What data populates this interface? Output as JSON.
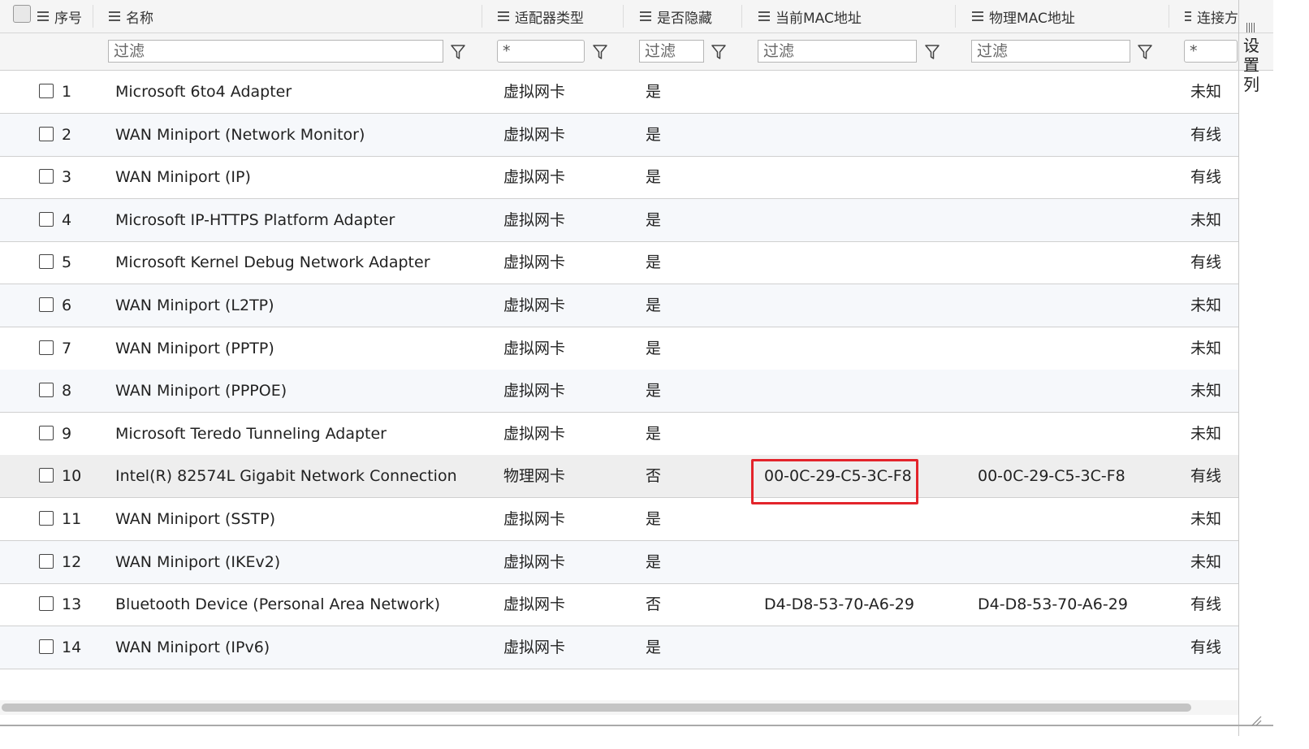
{
  "header": {
    "columns": [
      {
        "label": "序号"
      },
      {
        "label": "名称"
      },
      {
        "label": "适配器类型"
      },
      {
        "label": "是否隐藏"
      },
      {
        "label": "当前MAC地址"
      },
      {
        "label": "物理MAC地址"
      },
      {
        "label": "连接方"
      }
    ]
  },
  "filters": {
    "name": {
      "placeholder": "过滤"
    },
    "adapter_type": {
      "value": "*"
    },
    "hidden": {
      "placeholder": "过滤"
    },
    "current_mac": {
      "placeholder": "过滤"
    },
    "physical_mac": {
      "placeholder": "过滤"
    },
    "connection": {
      "value": "*"
    }
  },
  "settings": {
    "label_1": "设",
    "label_2": "置",
    "label_3": "列"
  },
  "rows": [
    {
      "index": "1",
      "name": "Microsoft 6to4 Adapter",
      "type": "虚拟网卡",
      "hidden": "是",
      "current_mac": "",
      "physical_mac": "",
      "connection": "未知"
    },
    {
      "index": "2",
      "name": "WAN Miniport (Network Monitor)",
      "type": "虚拟网卡",
      "hidden": "是",
      "current_mac": "",
      "physical_mac": "",
      "connection": "有线"
    },
    {
      "index": "3",
      "name": "WAN Miniport (IP)",
      "type": "虚拟网卡",
      "hidden": "是",
      "current_mac": "",
      "physical_mac": "",
      "connection": "有线"
    },
    {
      "index": "4",
      "name": "Microsoft IP-HTTPS Platform Adapter",
      "type": "虚拟网卡",
      "hidden": "是",
      "current_mac": "",
      "physical_mac": "",
      "connection": "未知"
    },
    {
      "index": "5",
      "name": "Microsoft Kernel Debug Network Adapter",
      "type": "虚拟网卡",
      "hidden": "是",
      "current_mac": "",
      "physical_mac": "",
      "connection": "有线"
    },
    {
      "index": "6",
      "name": "WAN Miniport (L2TP)",
      "type": "虚拟网卡",
      "hidden": "是",
      "current_mac": "",
      "physical_mac": "",
      "connection": "未知"
    },
    {
      "index": "7",
      "name": "WAN Miniport (PPTP)",
      "type": "虚拟网卡",
      "hidden": "是",
      "current_mac": "",
      "physical_mac": "",
      "connection": "未知"
    },
    {
      "index": "8",
      "name": "WAN Miniport (PPPOE)",
      "type": "虚拟网卡",
      "hidden": "是",
      "current_mac": "",
      "physical_mac": "",
      "connection": "未知"
    },
    {
      "index": "9",
      "name": "Microsoft Teredo Tunneling Adapter",
      "type": "虚拟网卡",
      "hidden": "是",
      "current_mac": "",
      "physical_mac": "",
      "connection": "未知"
    },
    {
      "index": "10",
      "name": "Intel(R) 82574L Gigabit Network Connection",
      "type": "物理网卡",
      "hidden": "否",
      "current_mac": "00-0C-29-C5-3C-F8",
      "physical_mac": "00-0C-29-C5-3C-F8",
      "connection": "有线"
    },
    {
      "index": "11",
      "name": "WAN Miniport (SSTP)",
      "type": "虚拟网卡",
      "hidden": "是",
      "current_mac": "",
      "physical_mac": "",
      "connection": "未知"
    },
    {
      "index": "12",
      "name": "WAN Miniport (IKEv2)",
      "type": "虚拟网卡",
      "hidden": "是",
      "current_mac": "",
      "physical_mac": "",
      "connection": "未知"
    },
    {
      "index": "13",
      "name": "Bluetooth Device (Personal Area Network)",
      "type": "虚拟网卡",
      "hidden": "否",
      "current_mac": "D4-D8-53-70-A6-29",
      "physical_mac": "D4-D8-53-70-A6-29",
      "connection": "有线"
    },
    {
      "index": "14",
      "name": "WAN Miniport (IPv6)",
      "type": "虚拟网卡",
      "hidden": "是",
      "current_mac": "",
      "physical_mac": "",
      "connection": "有线"
    }
  ],
  "colors": {
    "highlight": "#e3242b",
    "header_bg": "#f5f5f5",
    "alt_row_bg": "#f6f8fb"
  }
}
